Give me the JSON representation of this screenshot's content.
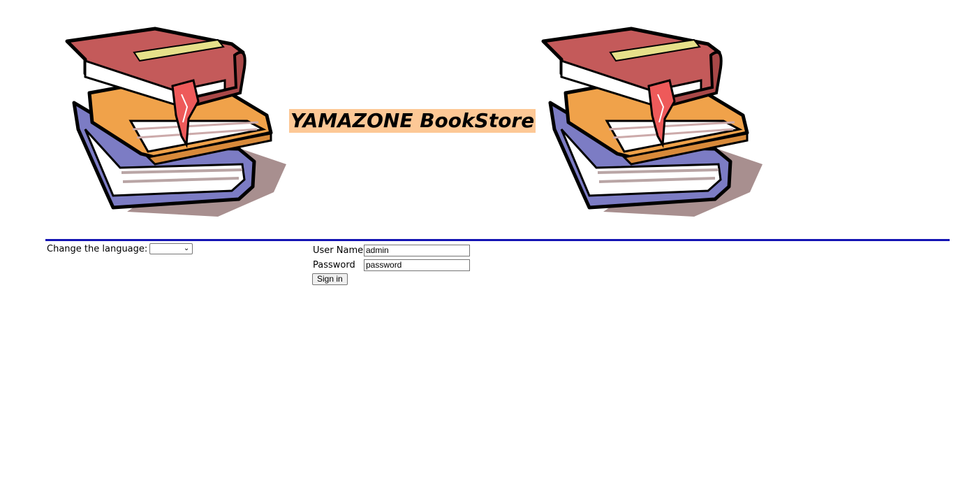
{
  "header": {
    "title": "YAMAZONE BookStore",
    "title_bg": "#fdc896",
    "images": [
      "books-stack-icon",
      "books-stack-icon"
    ]
  },
  "divider_color": "#1414b4",
  "language": {
    "label": "Change the language:",
    "selected": ""
  },
  "login": {
    "username_label": "User Name",
    "username_value": "admin",
    "password_label": "Password",
    "password_value": "password",
    "signin_label": "Sign in"
  }
}
